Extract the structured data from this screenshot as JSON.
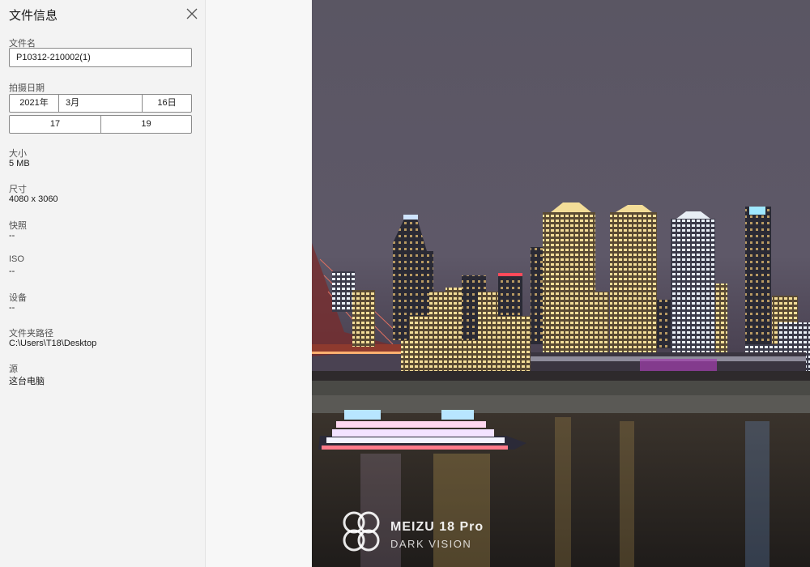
{
  "panel": {
    "title": "文件信息",
    "file_name_label": "文件名",
    "file_name_value": "P10312-210002(1)",
    "date_label": "拍摄日期",
    "date_year": "2021年",
    "date_month": "3月",
    "date_day": "16日",
    "time_hour": "17",
    "time_minute": "19",
    "size_label": "大小",
    "size_value": "5 MB",
    "dimensions_label": "尺寸",
    "dimensions_value": "4080 x 3060",
    "snapshot_label": "快照",
    "snapshot_value": "--",
    "iso_label": "ISO",
    "iso_value": "--",
    "device_label": "设备",
    "device_value": "--",
    "folder_path_label": "文件夹路径",
    "folder_path_value": "C:\\Users\\T18\\Desktop",
    "source_label": "源",
    "source_value": "这台电脑"
  },
  "photo": {
    "watermark_brand": "MEIZU 18 Pro",
    "watermark_sub": "DARK VISION"
  },
  "icons": {
    "close": "close-icon",
    "watermark_logo": "meizu-logo-icon"
  },
  "colors": {
    "panel_bg": "#f3f3f3",
    "sky_top": "#5d5866",
    "water": "#2a2521"
  }
}
